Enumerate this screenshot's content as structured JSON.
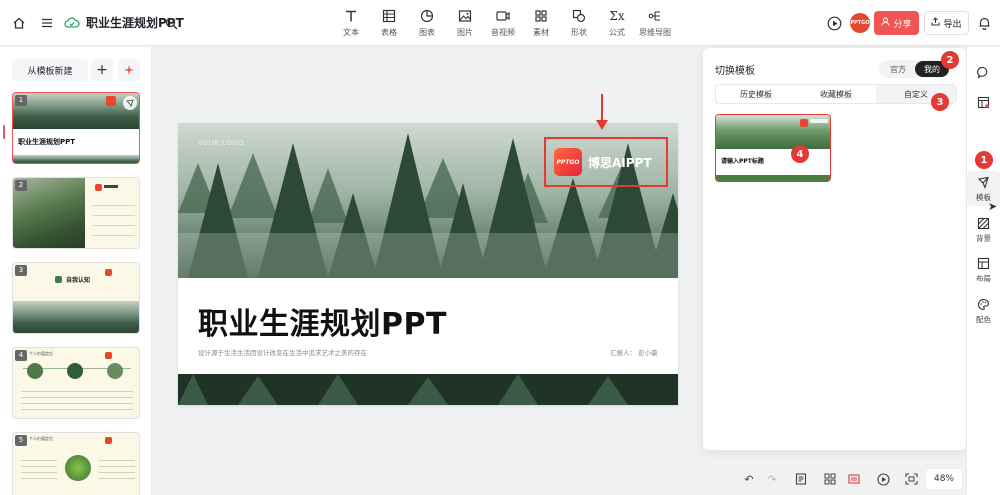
{
  "topbar": {
    "doc_title": "职业生涯规划PPT",
    "tools": [
      {
        "label": "文本",
        "icon": "text-icon"
      },
      {
        "label": "表格",
        "icon": "table-icon"
      },
      {
        "label": "图表",
        "icon": "chart-icon"
      },
      {
        "label": "图片",
        "icon": "image-icon"
      },
      {
        "label": "音视频",
        "icon": "video-icon"
      },
      {
        "label": "素材",
        "icon": "assets-icon"
      },
      {
        "label": "形状",
        "icon": "shape-icon"
      },
      {
        "label": "公式",
        "icon": "formula-icon"
      },
      {
        "label": "思维导图",
        "icon": "mindmap-icon"
      }
    ],
    "avatar_text": "PPTGO",
    "share_label": "分享",
    "export_label": "导出"
  },
  "left_panel": {
    "new_from_template": "从模板新建",
    "slides": [
      {
        "num": "1",
        "title": "职业生涯规划PPT"
      },
      {
        "num": "2",
        "title": ""
      },
      {
        "num": "3",
        "title": "自我认知"
      },
      {
        "num": "4",
        "title": "个人价值定位"
      },
      {
        "num": "5",
        "title": "个人价值定位"
      }
    ]
  },
  "slide": {
    "logo": "YOUR LOGO",
    "brand_logo": "PPTGO",
    "brand_name": "博思AIPPT",
    "title": "职业生涯规划PPT",
    "subtitle": "设计源于生活生活因设计改变在生活中追求艺术之美的存在",
    "reporter": "汇报人：  彭小豪"
  },
  "bottom_toolbar": {
    "zoom": "48%"
  },
  "template_panel": {
    "title": "切换模板",
    "segments": [
      "官方",
      "我的"
    ],
    "active_segment": "我的",
    "tabs": [
      "历史模板",
      "收藏模板",
      "自定义"
    ],
    "active_tab": "自定义",
    "card_title": "请输入PPT标题"
  },
  "right_rail": [
    {
      "label": "",
      "icon": "comment-icon"
    },
    {
      "label": "",
      "icon": "template-board-icon"
    },
    {
      "label": "模板",
      "icon": "template-icon"
    },
    {
      "label": "背景",
      "icon": "background-icon"
    },
    {
      "label": "布局",
      "icon": "layout-icon"
    },
    {
      "label": "配色",
      "icon": "palette-icon"
    }
  ],
  "badges": [
    "1",
    "2",
    "3",
    "4"
  ],
  "colors": {
    "accent": "#f05454",
    "annotation": "#e53935"
  }
}
